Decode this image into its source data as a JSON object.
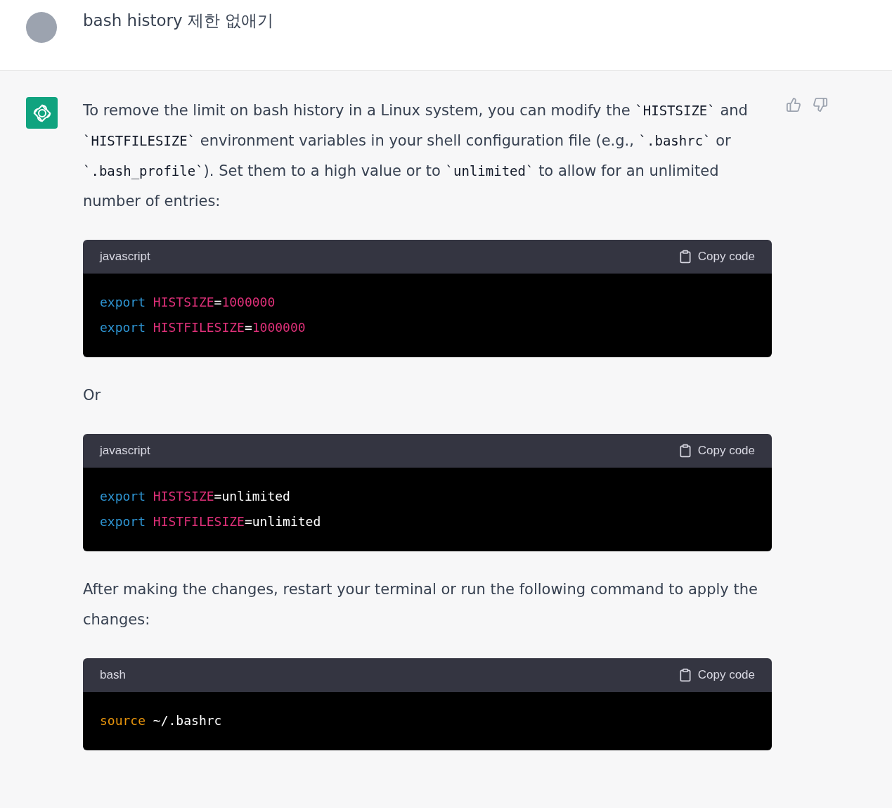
{
  "user_message": {
    "text": "bash history 제한 없애기"
  },
  "assistant_message": {
    "blocks": [
      {
        "kind": "paragraph",
        "segments": [
          {
            "kind": "text",
            "text": "To remove the limit on bash history in a Linux system, you can modify the "
          },
          {
            "kind": "code",
            "text": "`HISTSIZE`"
          },
          {
            "kind": "text",
            "text": " and "
          },
          {
            "kind": "code",
            "text": "`HISTFILESIZE`"
          },
          {
            "kind": "text",
            "text": " environment variables in your shell configuration file (e.g., "
          },
          {
            "kind": "code",
            "text": "`.bashrc`"
          },
          {
            "kind": "text",
            "text": " or "
          },
          {
            "kind": "code",
            "text": "`.bash_profile`"
          },
          {
            "kind": "text",
            "text": "). Set them to a high value or to "
          },
          {
            "kind": "code",
            "text": "`unlimited`"
          },
          {
            "kind": "text",
            "text": " to allow for an unlimited number of entries:"
          }
        ]
      },
      {
        "kind": "code",
        "language": "javascript",
        "copy_label": "Copy code",
        "lines": [
          [
            {
              "kind": "keyword",
              "text": "export"
            },
            {
              "kind": "variable",
              "text": "HISTSIZE"
            },
            {
              "kind": "plain",
              "text": "="
            },
            {
              "kind": "number",
              "text": "1000000"
            }
          ],
          [
            {
              "kind": "keyword",
              "text": "export"
            },
            {
              "kind": "variable",
              "text": "HISTFILESIZE"
            },
            {
              "kind": "plain",
              "text": "="
            },
            {
              "kind": "number",
              "text": "1000000"
            }
          ]
        ]
      },
      {
        "kind": "paragraph",
        "segments": [
          {
            "kind": "text",
            "text": "Or"
          }
        ]
      },
      {
        "kind": "code",
        "language": "javascript",
        "copy_label": "Copy code",
        "lines": [
          [
            {
              "kind": "keyword",
              "text": "export"
            },
            {
              "kind": "variable",
              "text": "HISTSIZE"
            },
            {
              "kind": "plain",
              "text": "=unlimited"
            }
          ],
          [
            {
              "kind": "keyword",
              "text": "export"
            },
            {
              "kind": "variable",
              "text": "HISTFILESIZE"
            },
            {
              "kind": "plain",
              "text": "=unlimited"
            }
          ]
        ]
      },
      {
        "kind": "paragraph",
        "segments": [
          {
            "kind": "text",
            "text": "After making the changes, restart your terminal or run the following command to apply the changes:"
          }
        ]
      },
      {
        "kind": "code",
        "language": "bash",
        "copy_label": "Copy code",
        "lines": [
          [
            {
              "kind": "builtin",
              "text": "source"
            },
            {
              "kind": "plain",
              "text": "~/.bashrc"
            }
          ]
        ]
      }
    ]
  }
}
